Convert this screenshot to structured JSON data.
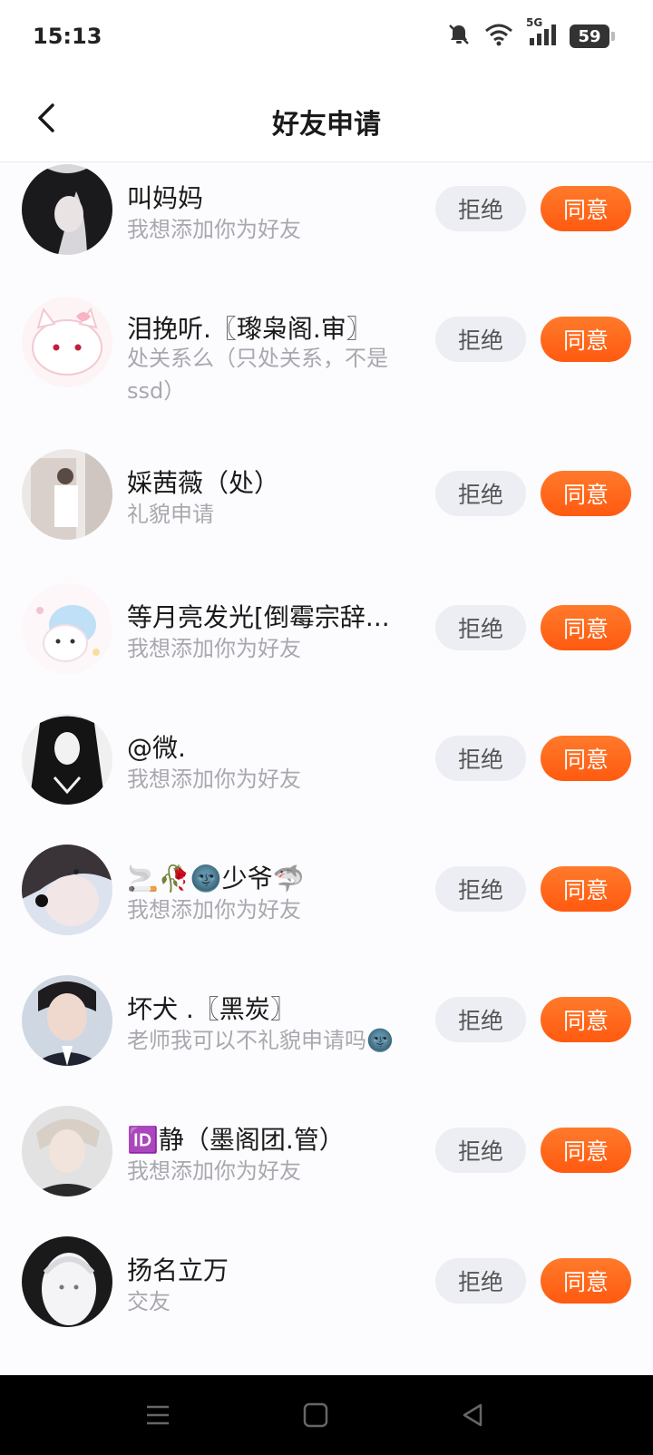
{
  "status_bar": {
    "time": "15:13",
    "network": "5G",
    "battery": "59"
  },
  "header": {
    "title": "好友申请"
  },
  "requests": [
    {
      "name": "叫妈妈",
      "message": "我想添加你为好友",
      "reject_label": "拒绝",
      "accept_label": "同意"
    },
    {
      "name": "泪挽听.〖瓈枭阁.审〗",
      "message": "处关系么（只处关系，不是ssd）",
      "reject_label": "拒绝",
      "accept_label": "同意"
    },
    {
      "name": "婇茜薇（处）",
      "message": "礼貌申请",
      "reject_label": "拒绝",
      "accept_label": "同意"
    },
    {
      "name": "等月亮发光[倒霉宗辞...",
      "message": "我想添加你为好友",
      "reject_label": "拒绝",
      "accept_label": "同意"
    },
    {
      "name": "@微.",
      "message": "我想添加你为好友",
      "reject_label": "拒绝",
      "accept_label": "同意"
    },
    {
      "name": "🚬🥀🌚少爷🦈",
      "message": "我想添加你为好友",
      "reject_label": "拒绝",
      "accept_label": "同意"
    },
    {
      "name": "坏犬 .〖黑炭〗",
      "message": "老师我可以不礼貌申请吗🌚",
      "reject_label": "拒绝",
      "accept_label": "同意"
    },
    {
      "name": "🆔静（墨阁团.管）",
      "message": "我想添加你为好友",
      "reject_label": "拒绝",
      "accept_label": "同意"
    },
    {
      "name": "扬名立万",
      "message": "交友",
      "reject_label": "拒绝",
      "accept_label": "同意"
    }
  ],
  "colors": {
    "accent": "#ff6a1a",
    "reject_bg": "#eceef3",
    "subtext": "#a8a8b0"
  }
}
